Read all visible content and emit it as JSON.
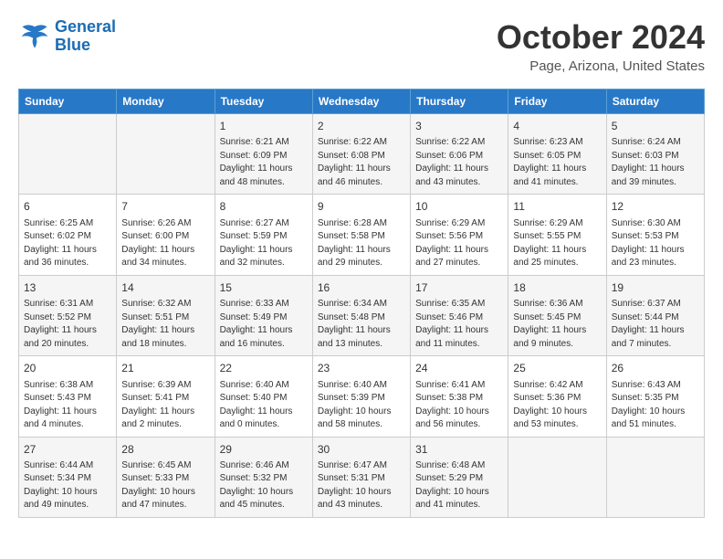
{
  "logo": {
    "line1": "General",
    "line2": "Blue"
  },
  "title": "October 2024",
  "location": "Page, Arizona, United States",
  "days_of_week": [
    "Sunday",
    "Monday",
    "Tuesday",
    "Wednesday",
    "Thursday",
    "Friday",
    "Saturday"
  ],
  "weeks": [
    [
      {
        "day": "",
        "info": ""
      },
      {
        "day": "",
        "info": ""
      },
      {
        "day": "1",
        "info": "Sunrise: 6:21 AM\nSunset: 6:09 PM\nDaylight: 11 hours and 48 minutes."
      },
      {
        "day": "2",
        "info": "Sunrise: 6:22 AM\nSunset: 6:08 PM\nDaylight: 11 hours and 46 minutes."
      },
      {
        "day": "3",
        "info": "Sunrise: 6:22 AM\nSunset: 6:06 PM\nDaylight: 11 hours and 43 minutes."
      },
      {
        "day": "4",
        "info": "Sunrise: 6:23 AM\nSunset: 6:05 PM\nDaylight: 11 hours and 41 minutes."
      },
      {
        "day": "5",
        "info": "Sunrise: 6:24 AM\nSunset: 6:03 PM\nDaylight: 11 hours and 39 minutes."
      }
    ],
    [
      {
        "day": "6",
        "info": "Sunrise: 6:25 AM\nSunset: 6:02 PM\nDaylight: 11 hours and 36 minutes."
      },
      {
        "day": "7",
        "info": "Sunrise: 6:26 AM\nSunset: 6:00 PM\nDaylight: 11 hours and 34 minutes."
      },
      {
        "day": "8",
        "info": "Sunrise: 6:27 AM\nSunset: 5:59 PM\nDaylight: 11 hours and 32 minutes."
      },
      {
        "day": "9",
        "info": "Sunrise: 6:28 AM\nSunset: 5:58 PM\nDaylight: 11 hours and 29 minutes."
      },
      {
        "day": "10",
        "info": "Sunrise: 6:29 AM\nSunset: 5:56 PM\nDaylight: 11 hours and 27 minutes."
      },
      {
        "day": "11",
        "info": "Sunrise: 6:29 AM\nSunset: 5:55 PM\nDaylight: 11 hours and 25 minutes."
      },
      {
        "day": "12",
        "info": "Sunrise: 6:30 AM\nSunset: 5:53 PM\nDaylight: 11 hours and 23 minutes."
      }
    ],
    [
      {
        "day": "13",
        "info": "Sunrise: 6:31 AM\nSunset: 5:52 PM\nDaylight: 11 hours and 20 minutes."
      },
      {
        "day": "14",
        "info": "Sunrise: 6:32 AM\nSunset: 5:51 PM\nDaylight: 11 hours and 18 minutes."
      },
      {
        "day": "15",
        "info": "Sunrise: 6:33 AM\nSunset: 5:49 PM\nDaylight: 11 hours and 16 minutes."
      },
      {
        "day": "16",
        "info": "Sunrise: 6:34 AM\nSunset: 5:48 PM\nDaylight: 11 hours and 13 minutes."
      },
      {
        "day": "17",
        "info": "Sunrise: 6:35 AM\nSunset: 5:46 PM\nDaylight: 11 hours and 11 minutes."
      },
      {
        "day": "18",
        "info": "Sunrise: 6:36 AM\nSunset: 5:45 PM\nDaylight: 11 hours and 9 minutes."
      },
      {
        "day": "19",
        "info": "Sunrise: 6:37 AM\nSunset: 5:44 PM\nDaylight: 11 hours and 7 minutes."
      }
    ],
    [
      {
        "day": "20",
        "info": "Sunrise: 6:38 AM\nSunset: 5:43 PM\nDaylight: 11 hours and 4 minutes."
      },
      {
        "day": "21",
        "info": "Sunrise: 6:39 AM\nSunset: 5:41 PM\nDaylight: 11 hours and 2 minutes."
      },
      {
        "day": "22",
        "info": "Sunrise: 6:40 AM\nSunset: 5:40 PM\nDaylight: 11 hours and 0 minutes."
      },
      {
        "day": "23",
        "info": "Sunrise: 6:40 AM\nSunset: 5:39 PM\nDaylight: 10 hours and 58 minutes."
      },
      {
        "day": "24",
        "info": "Sunrise: 6:41 AM\nSunset: 5:38 PM\nDaylight: 10 hours and 56 minutes."
      },
      {
        "day": "25",
        "info": "Sunrise: 6:42 AM\nSunset: 5:36 PM\nDaylight: 10 hours and 53 minutes."
      },
      {
        "day": "26",
        "info": "Sunrise: 6:43 AM\nSunset: 5:35 PM\nDaylight: 10 hours and 51 minutes."
      }
    ],
    [
      {
        "day": "27",
        "info": "Sunrise: 6:44 AM\nSunset: 5:34 PM\nDaylight: 10 hours and 49 minutes."
      },
      {
        "day": "28",
        "info": "Sunrise: 6:45 AM\nSunset: 5:33 PM\nDaylight: 10 hours and 47 minutes."
      },
      {
        "day": "29",
        "info": "Sunrise: 6:46 AM\nSunset: 5:32 PM\nDaylight: 10 hours and 45 minutes."
      },
      {
        "day": "30",
        "info": "Sunrise: 6:47 AM\nSunset: 5:31 PM\nDaylight: 10 hours and 43 minutes."
      },
      {
        "day": "31",
        "info": "Sunrise: 6:48 AM\nSunset: 5:29 PM\nDaylight: 10 hours and 41 minutes."
      },
      {
        "day": "",
        "info": ""
      },
      {
        "day": "",
        "info": ""
      }
    ]
  ]
}
